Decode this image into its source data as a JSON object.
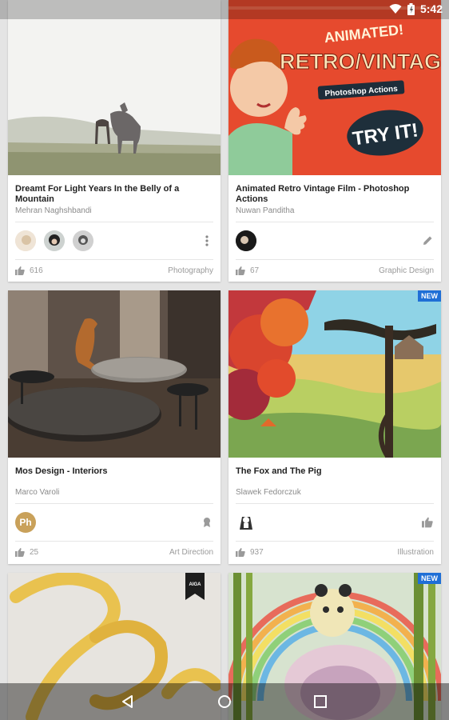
{
  "status_bar": {
    "time": "5:42",
    "icons": [
      "wifi-icon",
      "battery-icon"
    ]
  },
  "cards": [
    {
      "title": "Dreamt For Light Years In the Belly of a Mountain",
      "author": "Mehran Naghshbandi",
      "likes": "616",
      "category": "Photography",
      "action_icon": "more-vert-icon",
      "avatars": 3
    },
    {
      "title": "Animated Retro Vintage Film - Photoshop Actions",
      "author": "Nuwan Panditha",
      "likes": "67",
      "category": "Graphic Design",
      "action_icon": "edit-icon",
      "avatars": 1,
      "media_texts": {
        "line1": "ANIMATED!",
        "line2": "RETRO/VINTAGE",
        "line3": "Photoshop Actions",
        "cta": "TRY IT!"
      }
    },
    {
      "title": "Mos Design -  Interiors",
      "author": "Marco Varoli",
      "likes": "25",
      "category": "Art Direction",
      "action_icon": "ribbon-icon",
      "avatar_text": "Ph"
    },
    {
      "title": "The Fox and The Pig",
      "author": "Slawek Fedorczuk",
      "likes": "937",
      "category": "Illustration",
      "action_icon": "thumb-up-icon",
      "badge": "NEW"
    },
    {
      "media_label": "AIGA"
    },
    {
      "badge": "NEW"
    }
  ]
}
